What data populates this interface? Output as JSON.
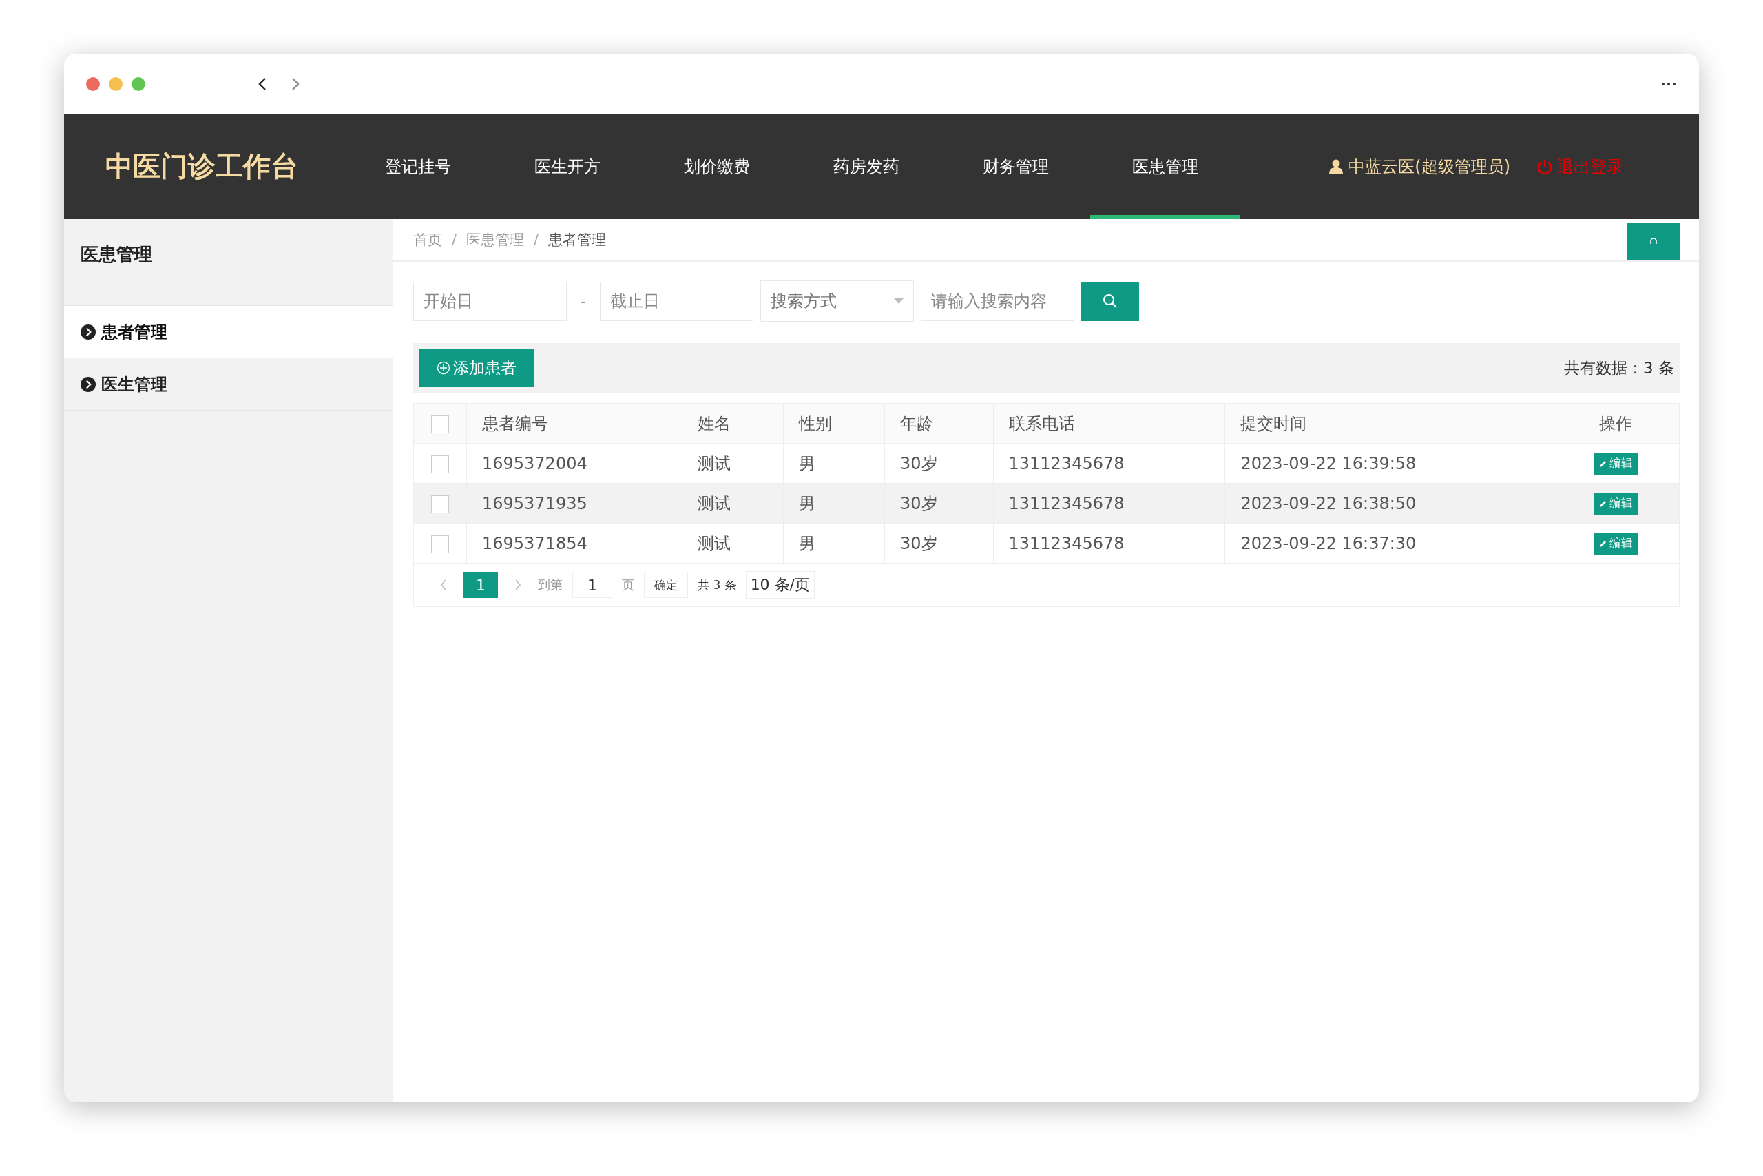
{
  "app": {
    "title": "中医门诊工作台"
  },
  "nav": [
    {
      "label": "登记挂号",
      "selected": false
    },
    {
      "label": "医生开方",
      "selected": false
    },
    {
      "label": "划价缴费",
      "selected": false
    },
    {
      "label": "药房发药",
      "selected": false
    },
    {
      "label": "财务管理",
      "selected": false
    },
    {
      "label": "医患管理",
      "selected": true
    }
  ],
  "user": {
    "name": "中蓝云医(超级管理员)",
    "logout": "退出登录"
  },
  "sidebar": {
    "title": "医患管理",
    "items": [
      {
        "label": "患者管理",
        "selected": true
      },
      {
        "label": "医生管理",
        "selected": false
      }
    ]
  },
  "breadcrumb": [
    {
      "kind": "link",
      "label": "首页"
    },
    {
      "kind": "separator",
      "label": "/"
    },
    {
      "kind": "link",
      "label": "医患管理"
    },
    {
      "kind": "separator",
      "label": "/"
    },
    {
      "kind": "current",
      "label": "患者管理"
    }
  ],
  "filters": {
    "start_date": {
      "placeholder": "开始日"
    },
    "separator": "-",
    "end_date": {
      "placeholder": "截止日"
    },
    "search_mode": {
      "placeholder": "搜索方式"
    },
    "keyword": {
      "placeholder": "请输入搜索内容"
    }
  },
  "toolbar": {
    "add_button": "添加患者",
    "total": "共有数据：3 条"
  },
  "table": {
    "select_all": {
      "checked": false
    },
    "columns": [
      "患者编号",
      "姓名",
      "性别",
      "年龄",
      "联系电话",
      "提交时间",
      "操作"
    ],
    "rows": [
      {
        "checked": false,
        "hovered": false,
        "cells": [
          "1695372004",
          "测试",
          "男",
          "30岁",
          "13112345678",
          "2023-09-22 16:39:58"
        ],
        "action": "编辑"
      },
      {
        "checked": false,
        "hovered": true,
        "cells": [
          "1695371935",
          "测试",
          "男",
          "30岁",
          "13112345678",
          "2023-09-22 16:38:50"
        ],
        "action": "编辑"
      },
      {
        "checked": false,
        "hovered": false,
        "cells": [
          "1695371854",
          "测试",
          "男",
          "30岁",
          "13112345678",
          "2023-09-22 16:37:30"
        ],
        "action": "编辑"
      }
    ]
  },
  "pagination": {
    "pages": [
      {
        "label": "1",
        "selected": true
      }
    ],
    "goto_label": "到第",
    "goto_value": "1",
    "page_unit": "页",
    "confirm": "确定",
    "total": "共 3 条",
    "page_size": "10 条/页"
  }
}
